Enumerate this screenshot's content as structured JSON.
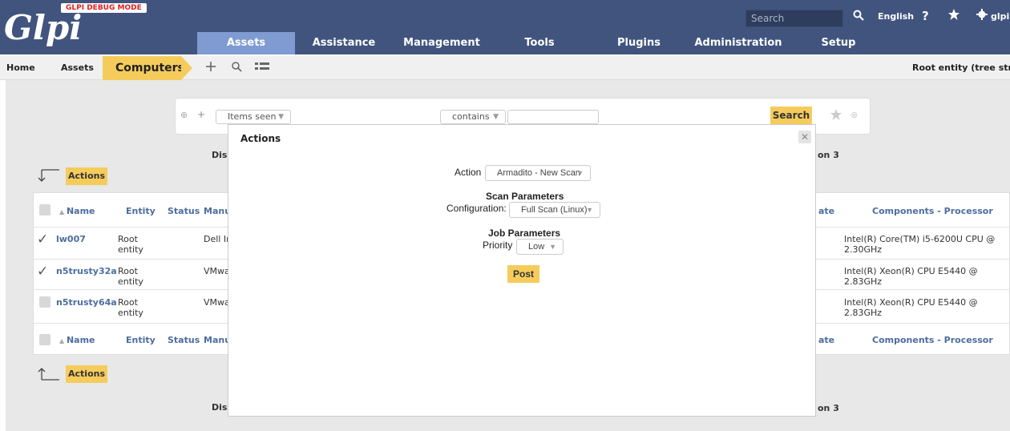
{
  "header": {
    "logo": "Glpi",
    "debug_badge": "GLPI DEBUG MODE",
    "search_placeholder": "Search",
    "language": "English",
    "help": "?",
    "user": "glpi"
  },
  "nav": [
    "Assets",
    "Assistance",
    "Management",
    "Tools",
    "Plugins",
    "Administration",
    "Setup"
  ],
  "breadcrumb": {
    "home": "Home",
    "section": "Assets",
    "current": "Computers",
    "entity": "Root entity (tree stru"
  },
  "search": {
    "field": "Items seen",
    "operator": "contains",
    "value": "",
    "button": "Search"
  },
  "page": {
    "display_left": "Disp",
    "pager_right": "on 3",
    "actions_label": "Actions"
  },
  "table": {
    "headers": {
      "name": "Name",
      "entity": "Entity",
      "status": "Status",
      "manu": "Manu",
      "date": "ate",
      "processor": "Components - Processor"
    },
    "rows": [
      {
        "name": "lw007",
        "entity": "Root entity",
        "manu": "Dell In",
        "processor": "Intel(R) Core(TM) i5-6200U CPU @ 2.30GHz",
        "checked": true
      },
      {
        "name": "n5trusty32a",
        "entity": "Root entity",
        "manu": "VMwa",
        "processor": "Intel(R) Xeon(R) CPU E5440 @ 2.83GHz",
        "checked": true
      },
      {
        "name": "n5trusty64a",
        "entity": "Root entity",
        "manu": "VMwa",
        "processor": "Intel(R) Xeon(R) CPU E5440 @ 2.83GHz",
        "checked": false
      }
    ]
  },
  "modal": {
    "title": "Actions",
    "action_label": "Action",
    "action_value": "Armadito - New Scan",
    "scan_heading": "Scan Parameters",
    "config_label": "Configuration:",
    "config_value": "Full Scan (Linux)",
    "job_heading": "Job Parameters",
    "priority_label": "Priority",
    "priority_value": "Low",
    "post_button": "Post"
  },
  "colors": {
    "header": "#41547e",
    "nav_active": "#7f9bd1",
    "accent": "#f5cc5c",
    "link": "#4c6da0",
    "debug": "#e02020"
  }
}
